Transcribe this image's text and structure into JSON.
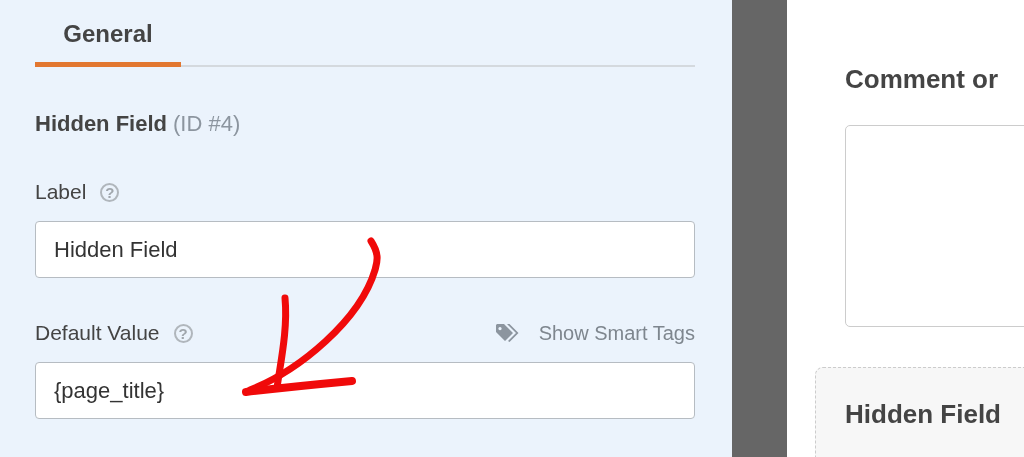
{
  "tabs": [
    {
      "label": "General",
      "selected": true
    }
  ],
  "field_options": {
    "title": "Hidden Field",
    "id": "(ID #4)",
    "fields": [
      {
        "label": "Label",
        "help": "?",
        "value": "Hidden Field"
      },
      {
        "label": "Default Value",
        "help": "?",
        "value": "{page_title}",
        "smart_tags": "Show Smart Tags"
      }
    ]
  },
  "preview": {
    "fields": [
      {
        "kind": "textarea",
        "label": "Comment or"
      },
      {
        "kind": "hidden",
        "label": "Hidden Field"
      }
    ]
  }
}
